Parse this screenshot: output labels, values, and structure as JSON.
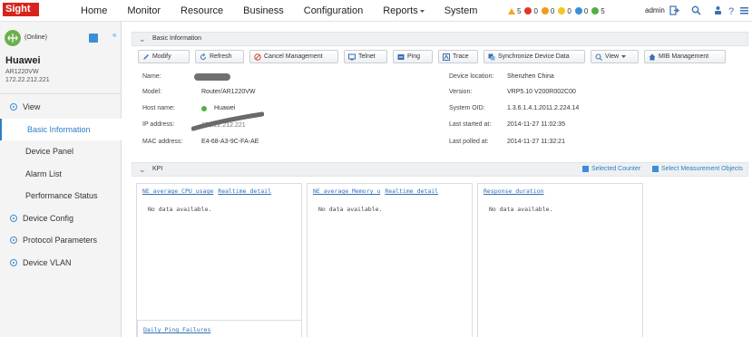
{
  "topbar": {
    "logo": "Sight",
    "nav": [
      {
        "label": "Home",
        "caret": false
      },
      {
        "label": "Monitor",
        "caret": false
      },
      {
        "label": "Resource",
        "caret": false
      },
      {
        "label": "Business",
        "caret": false
      },
      {
        "label": "Configuration",
        "caret": false
      },
      {
        "label": "Reports",
        "caret": true
      },
      {
        "label": "System",
        "caret": false
      }
    ],
    "alarms": [
      {
        "count": "5",
        "color": "#f2a81d",
        "shape": "triangle"
      },
      {
        "count": "0",
        "color": "#e0372b",
        "shape": "dot"
      },
      {
        "count": "0",
        "color": "#f29a1d",
        "shape": "dot"
      },
      {
        "count": "0",
        "color": "#f2c81d",
        "shape": "dot"
      },
      {
        "count": "0",
        "color": "#3a8fd8",
        "shape": "dot"
      },
      {
        "count": "5",
        "color": "#52b043",
        "shape": "dot"
      }
    ],
    "user": "admin",
    "icons": [
      "logout-icon",
      "search-icon",
      "user-group-icon",
      "help-icon",
      "settings-icon"
    ]
  },
  "sidebar": {
    "status": "(Online)",
    "device_name": "Huawei",
    "device_model": "AR1220VW",
    "device_ip": "172.22.212.221",
    "items": [
      {
        "label": "View",
        "type": "group"
      },
      {
        "label": "Basic Information",
        "type": "child",
        "active": true
      },
      {
        "label": "Device Panel",
        "type": "child"
      },
      {
        "label": "Alarm List",
        "type": "child"
      },
      {
        "label": "Performance Status",
        "type": "child"
      },
      {
        "label": "Device Config",
        "type": "group"
      },
      {
        "label": "Protocol Parameters",
        "type": "group"
      },
      {
        "label": "Device VLAN",
        "type": "group"
      }
    ]
  },
  "basic_info": {
    "title": "Basic Information",
    "toolbar": [
      {
        "label": "Modify",
        "icon": "pencil-icon"
      },
      {
        "label": "Refresh",
        "icon": "refresh-icon"
      },
      {
        "label": "Cancel Management",
        "icon": "cancel-icon"
      },
      {
        "label": "Telnet",
        "icon": "telnet-icon"
      },
      {
        "label": "Ping",
        "icon": "ping-icon"
      },
      {
        "label": "Trace",
        "icon": "trace-icon"
      },
      {
        "label": "Synchronize Device Data",
        "icon": "sync-icon"
      },
      {
        "label": "View",
        "icon": "view-icon",
        "caret": true
      },
      {
        "label": "MIB Management",
        "icon": "home-icon"
      }
    ],
    "left": [
      {
        "label": "Name:",
        "value": ""
      },
      {
        "label": "Model:",
        "value": "Router/AR1220VW"
      },
      {
        "label": "Host name:",
        "value": "Huawei"
      },
      {
        "label": "IP address:",
        "value": "172.22.212.221"
      },
      {
        "label": "MAC address:",
        "value": "E4-68-A3-9C-FA-AE"
      }
    ],
    "right": [
      {
        "label": "Device location:",
        "value": "Shenzhen China"
      },
      {
        "label": "Version:",
        "value": "VRP5.10 V200R002C00"
      },
      {
        "label": "System OID:",
        "value": "1.3.6.1.4.1.2011.2.224.14"
      },
      {
        "label": "Last started at:",
        "value": "2014-11-27 11:02:35"
      },
      {
        "label": "Last polled at:",
        "value": "2014-11-27 11:32:21"
      }
    ]
  },
  "kpi": {
    "title": "KPI",
    "selected_counter": "Selected Counter",
    "select_objects": "Select Measurement Objects",
    "panels": [
      {
        "title": "NE average CPU usage",
        "link": "Realtime detail",
        "empty": "No data available."
      },
      {
        "title": "NE average Memory u",
        "link": "Realtime detail",
        "empty": "No data available."
      },
      {
        "title": "Response duration",
        "link": "",
        "empty": "No data available."
      }
    ],
    "bottom_panel": "Daily Ping Failures"
  }
}
